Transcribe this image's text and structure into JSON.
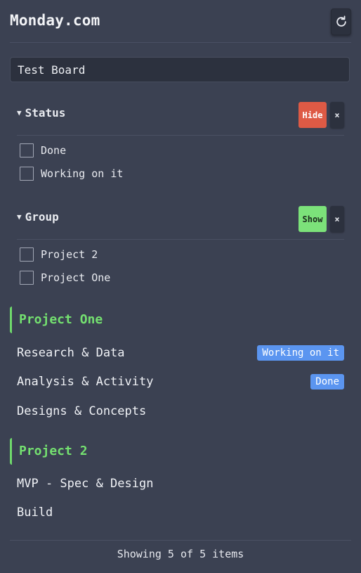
{
  "app": {
    "title": "Monday.com"
  },
  "toolbar": {
    "refresh_icon": "refresh-icon"
  },
  "board": {
    "value": "Test Board"
  },
  "filters": {
    "status": {
      "label": "Status",
      "toggle_label": "Hide",
      "clear_label": "×",
      "options": [
        "Done",
        "Working on it"
      ]
    },
    "group": {
      "label": "Group",
      "toggle_label": "Show",
      "clear_label": "×",
      "options": [
        "Project 2",
        "Project One"
      ]
    }
  },
  "groups": [
    {
      "title": "Project One",
      "items": [
        {
          "name": "Research & Data",
          "status": "Working on it"
        },
        {
          "name": "Analysis & Activity",
          "status": "Done"
        },
        {
          "name": "Designs & Concepts",
          "status": ""
        }
      ]
    },
    {
      "title": "Project 2",
      "items": [
        {
          "name": "MVP - Spec & Design",
          "status": ""
        },
        {
          "name": "Build",
          "status": ""
        }
      ]
    }
  ],
  "footer": {
    "summary": "Showing 5 of 5 items"
  },
  "colors": {
    "background": "#3b4152",
    "group_accent": "#74e070",
    "hide_button": "#de5a45",
    "show_button": "#7ce27a",
    "status_badge": "#5b95f0"
  }
}
